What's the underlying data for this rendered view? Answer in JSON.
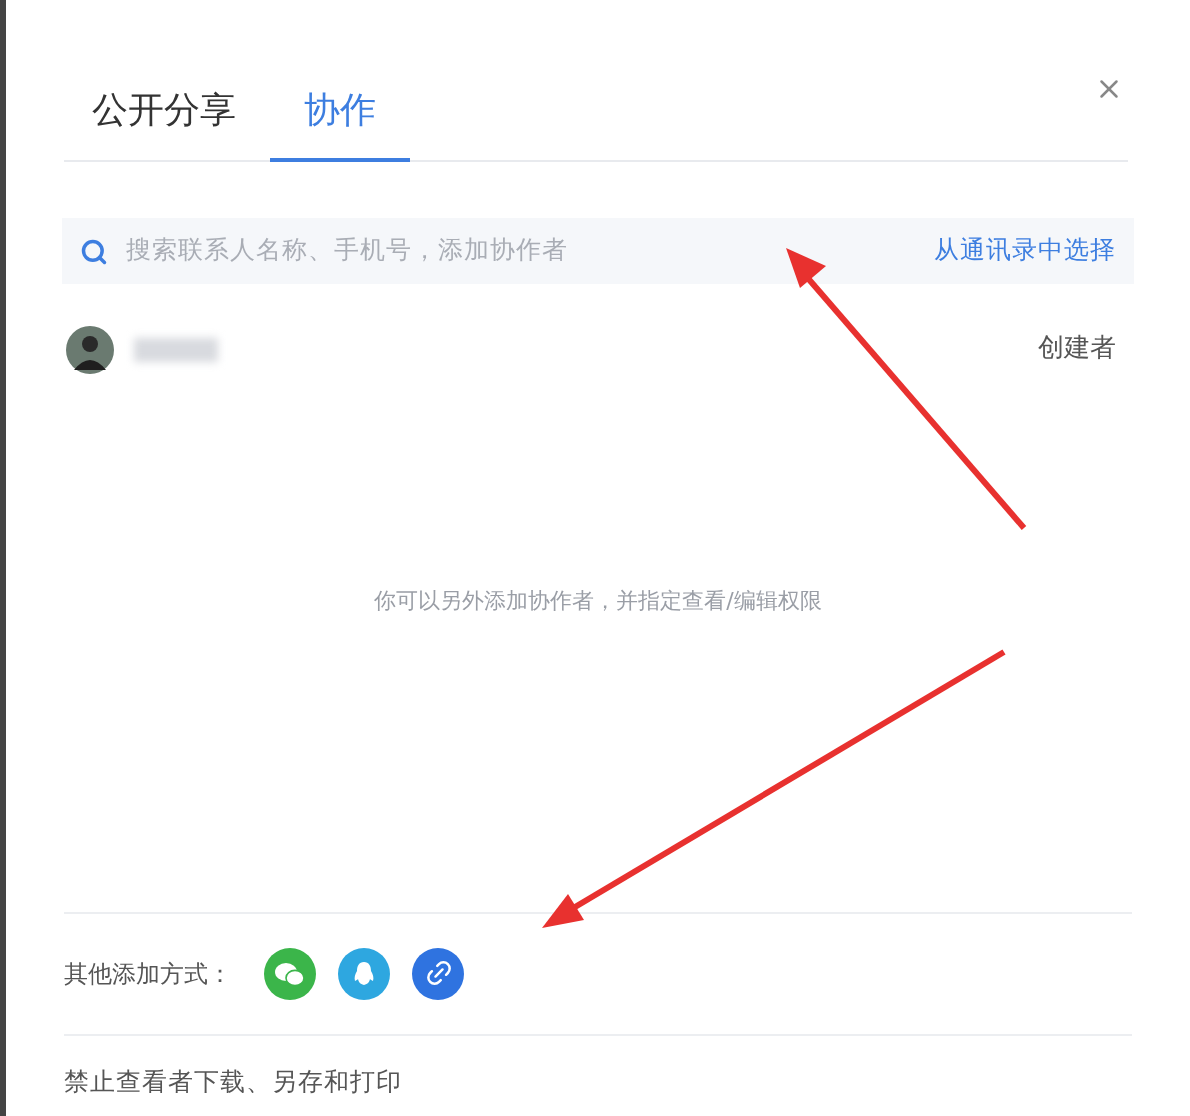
{
  "tabs": [
    {
      "label": "公开分享",
      "selected": false
    },
    {
      "label": "协作",
      "selected": true
    }
  ],
  "search": {
    "placeholder": "搜索联系人名称、手机号，添加协作者",
    "action": "从通讯录中选择"
  },
  "members": [
    {
      "role": "创建者"
    }
  ],
  "empty_hint": "你可以另外添加协作者，并指定查看/编辑权限",
  "other_methods": {
    "label": "其他添加方式：",
    "items": [
      {
        "kind": "wechat",
        "color": "#3bb54a"
      },
      {
        "kind": "qq",
        "color": "#2ea7e0"
      },
      {
        "kind": "link",
        "color": "#2f73e0"
      }
    ]
  },
  "settings": [
    {
      "label": "禁止查看者下载、另存和打印"
    }
  ]
}
